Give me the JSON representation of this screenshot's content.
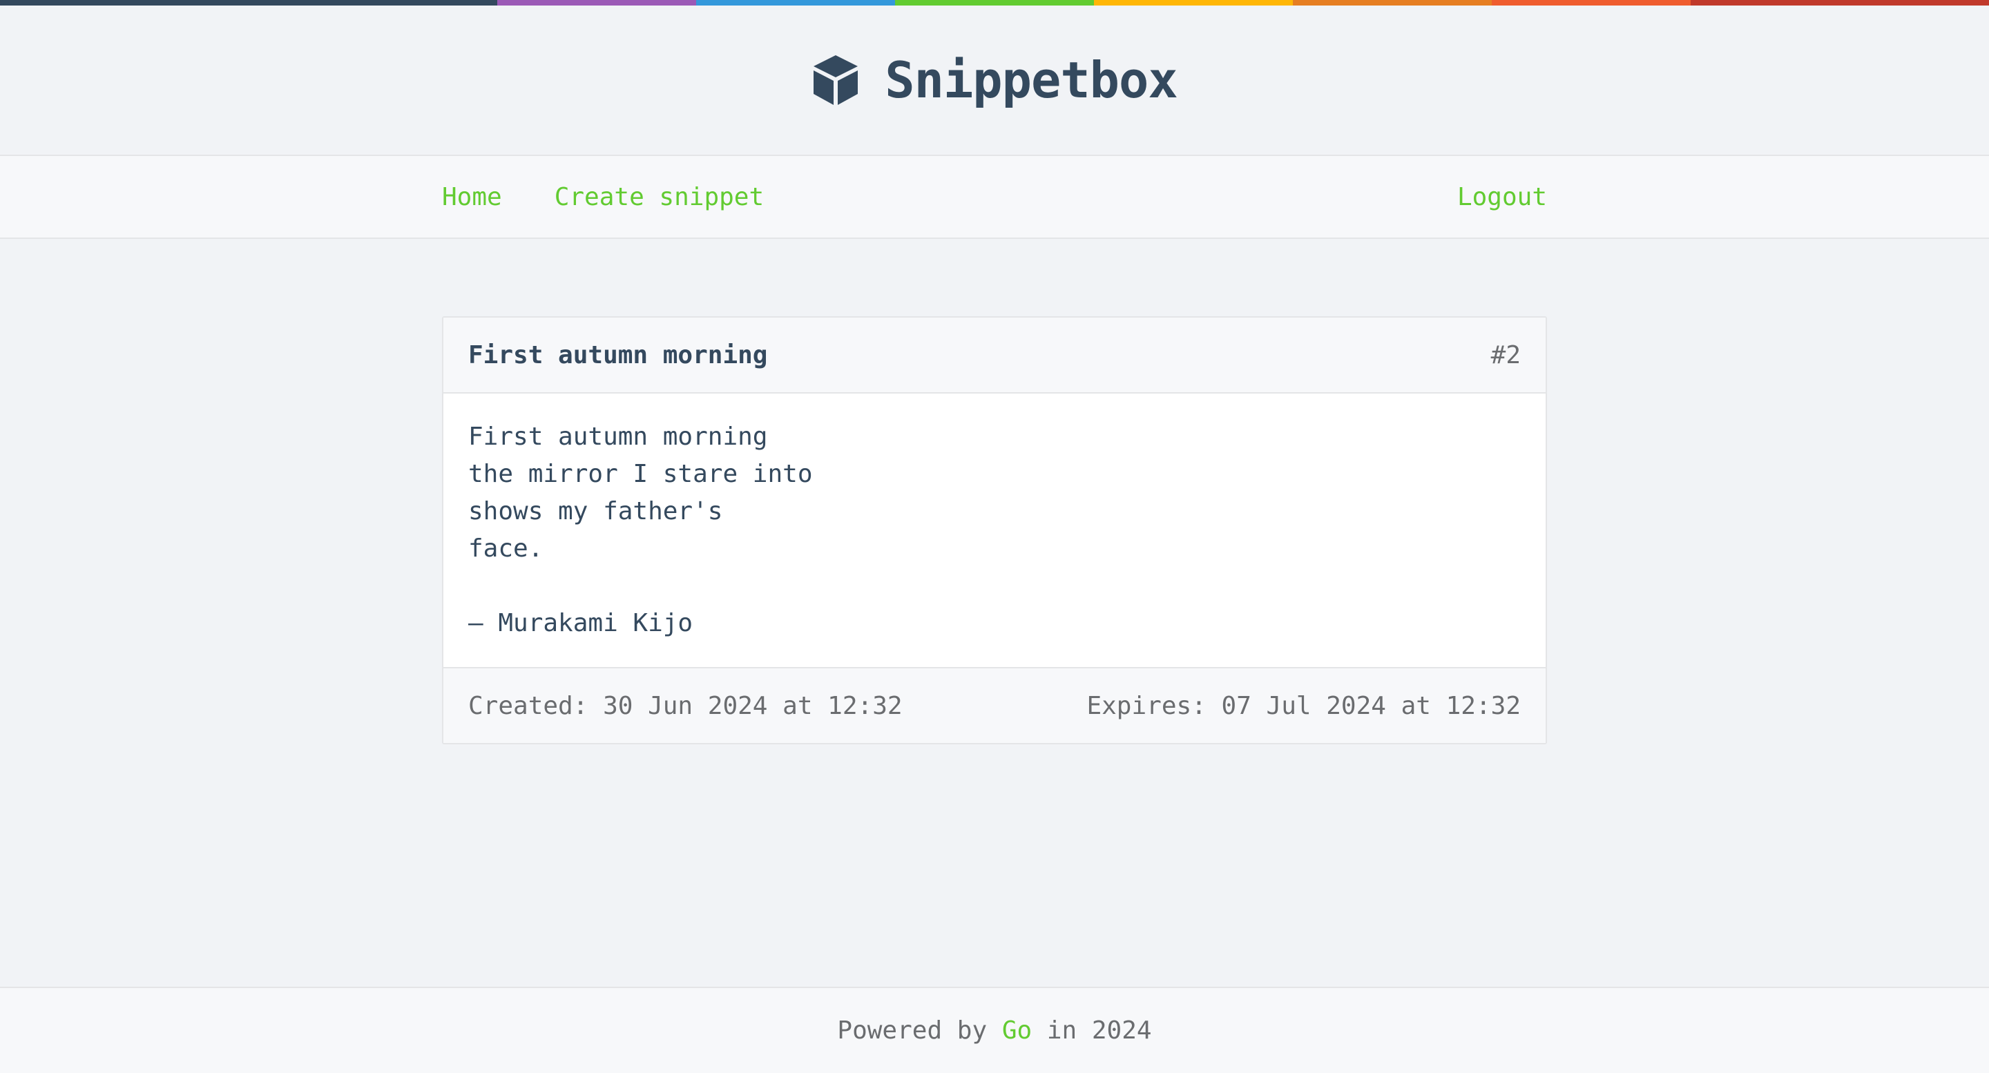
{
  "stripe_colors": [
    "#34495e",
    "#9b59b6",
    "#3498db",
    "#62cb31",
    "#ffb606",
    "#e67e22",
    "#ef5c2e",
    "#c0392b"
  ],
  "colors": {
    "accent": "#62cb31",
    "brand_text": "#34495e",
    "muted_text": "#6a6c6f",
    "background": "#f1f3f6",
    "panel_background": "#f7f8fa"
  },
  "header": {
    "logo_icon": "cube-icon",
    "title": "Snippetbox"
  },
  "nav": {
    "home": "Home",
    "create": "Create snippet",
    "logout": "Logout"
  },
  "snippet": {
    "title": "First autumn morning",
    "id": "#2",
    "content": "First autumn morning\nthe mirror I stare into\nshows my father's\nface.\n\n– Murakami Kijo",
    "created": "Created: 30 Jun 2024 at 12:32",
    "expires": "Expires: 07 Jul 2024 at 12:32"
  },
  "footer": {
    "prefix": "Powered by ",
    "link": "Go",
    "suffix": " in 2024"
  }
}
